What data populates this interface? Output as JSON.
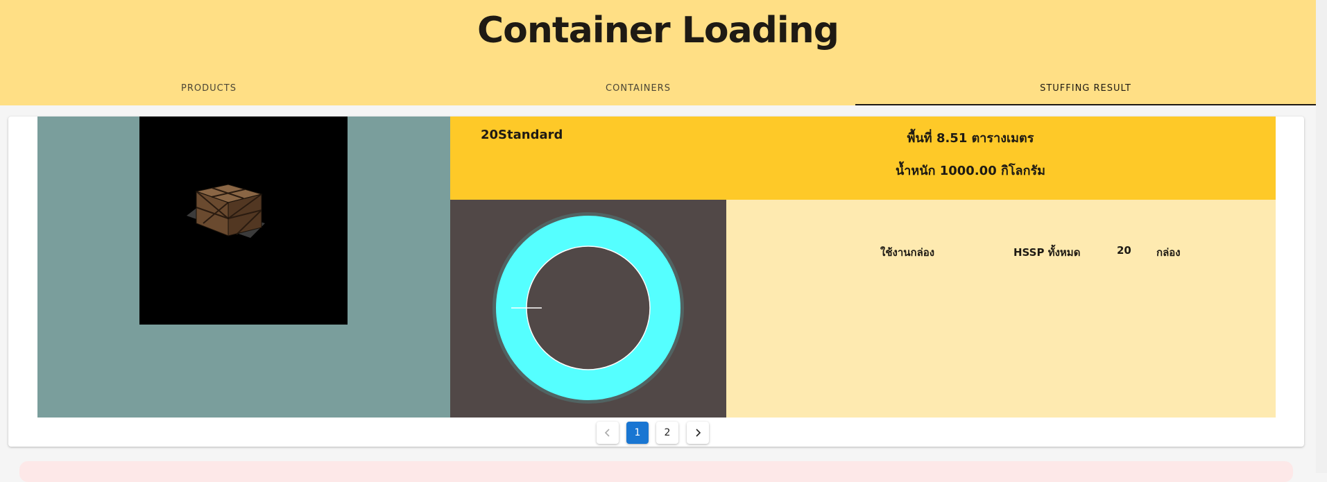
{
  "header": {
    "title": "Container Loading",
    "tabs": [
      {
        "label": "PRODUCTS",
        "active": false
      },
      {
        "label": "CONTAINERS",
        "active": false
      },
      {
        "label": "STUFFING RESULT",
        "active": true
      }
    ]
  },
  "result": {
    "container_name": "20Standard",
    "area_text": "พื้นที่ 8.51 ตารางเมตร",
    "weight_text": "น้ำหนัก 1000.00 กิโลกรัม",
    "usage_label": "ใช้งานกล่อง",
    "product_label": "HSSP ทั้งหมด",
    "count": "20",
    "unit_label": "กล่อง"
  },
  "donut": {
    "slice_fraction": 1.0,
    "color_fill": "#55ffff",
    "color_background": "#514847"
  },
  "pagination": {
    "prev_icon": "chevron-left-icon",
    "next_icon": "chevron-right-icon",
    "pages": [
      "1",
      "2"
    ],
    "current": "1"
  },
  "colors": {
    "header_bg": "#ffdf85",
    "info_header_bg": "#fec928",
    "detail_bg": "#feeab0",
    "viewer_bg": "#7a9e9c",
    "active_page": "#1976d2"
  }
}
